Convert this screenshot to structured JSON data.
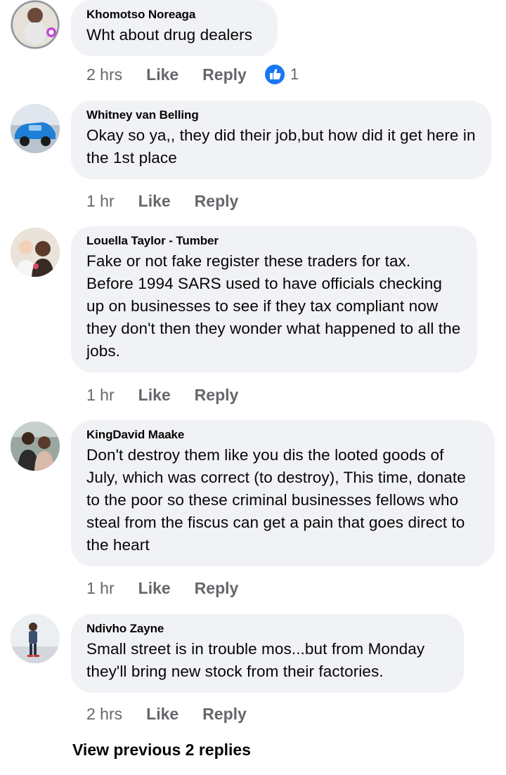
{
  "comments": [
    {
      "author": "Khomotso Noreaga",
      "text": "Wht about drug dealers",
      "time": "2 hrs",
      "like_label": "Like",
      "reply_label": "Reply",
      "reaction_count": "1",
      "reaction_icon": "thumbs-up-icon"
    },
    {
      "author": "Whitney van Belling",
      "text": "Okay so ya,, they did their job,but how did it get here in the 1st place",
      "time": "1 hr",
      "like_label": "Like",
      "reply_label": "Reply"
    },
    {
      "author": "Louella Taylor - Tumber",
      "text": "Fake or not fake register these traders for tax. Before 1994 SARS used to have officials checking up on businesses to see if they tax compliant now they don't then they wonder what happened to all the jobs.",
      "time": "1 hr",
      "like_label": "Like",
      "reply_label": "Reply"
    },
    {
      "author": "KingDavid Maake",
      "text": "Don't destroy them like you dis the looted goods of July, which was correct (to destroy), This time, donate to the poor so these criminal businesses fellows who steal from the fiscus can get a pain that goes direct to the heart",
      "time": "1 hr",
      "like_label": "Like",
      "reply_label": "Reply"
    },
    {
      "author": "Ndivho Zayne",
      "text": "Small street is in trouble mos...but from Monday they'll bring new stock from their factories.",
      "time": "2 hrs",
      "like_label": "Like",
      "reply_label": "Reply"
    }
  ],
  "view_previous_label": "View previous 2 replies",
  "colors": {
    "bubble_bg": "#f0f2f5",
    "secondary_text": "#65676b",
    "like_blue": "#1877f2"
  }
}
